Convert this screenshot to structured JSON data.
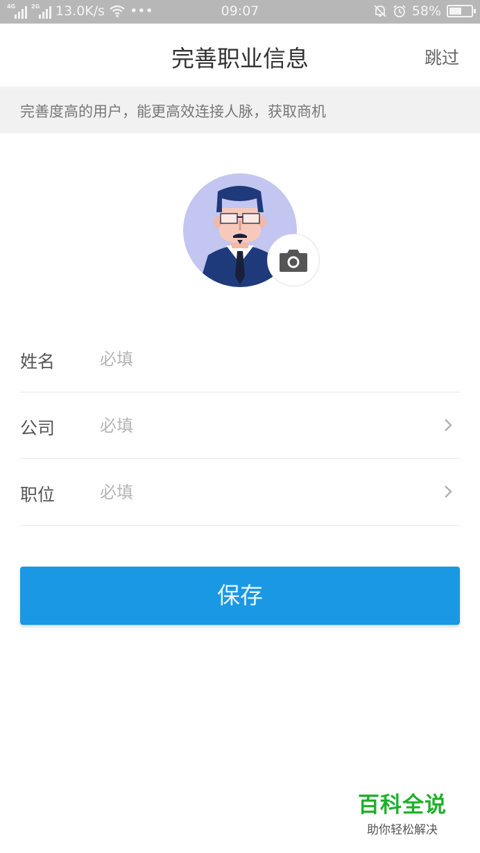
{
  "status_bar": {
    "signal_1_label": "4G",
    "signal_2_label": "2G",
    "network_speed": "13.0K/s",
    "more": "•••",
    "time": "09:07",
    "battery_percent": "58%",
    "battery_level": 0.58,
    "icons": [
      "signal-icon",
      "signal-icon",
      "wifi-icon",
      "mute-bell-icon",
      "alarm-icon",
      "battery-icon"
    ]
  },
  "header": {
    "title": "完善职业信息",
    "skip_label": "跳过"
  },
  "notice": {
    "text": "完善度高的用户，能更高效连接人脉，获取商机"
  },
  "avatar": {
    "icon": "camera-icon",
    "bg_color": "#c3c6f0"
  },
  "form": {
    "name": {
      "label": "姓名",
      "placeholder": "必填",
      "value": ""
    },
    "company": {
      "label": "公司",
      "placeholder": "必填",
      "value": ""
    },
    "position": {
      "label": "职位",
      "placeholder": "必填",
      "value": ""
    }
  },
  "save_button": {
    "label": "保存",
    "color": "#1a98e4"
  },
  "watermark": {
    "title": "百科全说",
    "subtitle": "助你轻松解决"
  }
}
